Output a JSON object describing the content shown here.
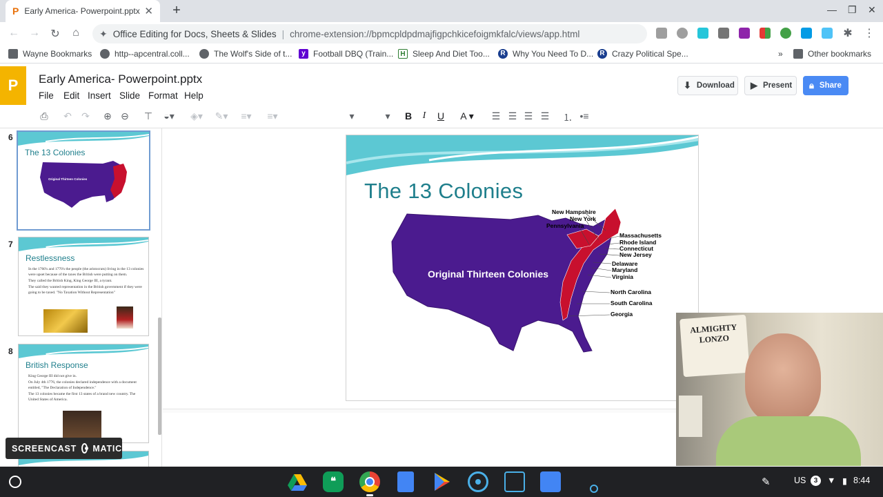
{
  "browser": {
    "tab_title": "Early America- Powerpoint.pptx",
    "omnibox_site": "Office Editing for Docs, Sheets & Slides",
    "omnibox_url": "chrome-extension://bpmcpldpdmajfigpchkicefoigmkfalc/views/app.html"
  },
  "bookmarks": [
    {
      "label": "Wayne Bookmarks",
      "icon": "folder-icon"
    },
    {
      "label": "http--apcentral.coll...",
      "icon": "globe-icon"
    },
    {
      "label": "The Wolf's Side of t...",
      "icon": "globe-icon"
    },
    {
      "label": "Football DBQ (Train...",
      "icon": "yahoo-icon"
    },
    {
      "label": "Sleep And Diet Too...",
      "icon": "h-icon"
    },
    {
      "label": "Why You Need To D...",
      "icon": "r-icon"
    },
    {
      "label": "Crazy Political Spe...",
      "icon": "r-icon"
    }
  ],
  "bookmarks_other": "Other bookmarks",
  "app": {
    "logo": "P",
    "doc_title": "Early America- Powerpoint.pptx",
    "menus": [
      "File",
      "Edit",
      "Insert",
      "Slide",
      "Format",
      "Help"
    ],
    "download_label": "Download",
    "present_label": "Present",
    "share_label": "Share"
  },
  "slides": [
    {
      "num": "6",
      "title": "The 13 Colonies",
      "map_label": "Original Thirteen Colonies"
    },
    {
      "num": "7",
      "title": "Restlessness",
      "bullets": [
        "In the 1760's and 1770's the people (the aristocrats) living in the 13 colonies were upset because of the taxes the British were putting on them.",
        "They called the British King, King George III, a tyrant.",
        "The said they wanted representation in the British government if they were going to be taxed. \"No Taxation Without Representation\""
      ]
    },
    {
      "num": "8",
      "title": "British Response",
      "bullets": [
        "King George III did not give in.",
        "On July 4th 1776, the colonies declared independence with a document entitled, \"The Declaration of Independence.\"",
        "The 13 colonies became the first 13 states of a brand new country. The United States of America."
      ]
    }
  ],
  "current_slide": {
    "title": "The 13 Colonies",
    "map_label": "Original Thirteen Colonies",
    "state_labels": [
      "New Hampshire",
      "New York",
      "Pennsylvania",
      "Massachusetts",
      "Rhode Island",
      "Connecticut",
      "New Jersey",
      "Delaware",
      "Maryland",
      "Virginia",
      "North Carolina",
      "South Carolina",
      "Georgia"
    ]
  },
  "watermark": {
    "left": "SCREENCAST",
    "right": "MATIC"
  },
  "webcam_sign": "ALMIGHTY LONZO",
  "tray": {
    "locale": "US",
    "badge": "3",
    "time": "8:44"
  },
  "colors": {
    "accent": "#4a8af4",
    "logo": "#f4b400",
    "title_teal": "#1f7f8c",
    "map_purple": "#4b1b8f",
    "colonies_red": "#c8102e"
  }
}
